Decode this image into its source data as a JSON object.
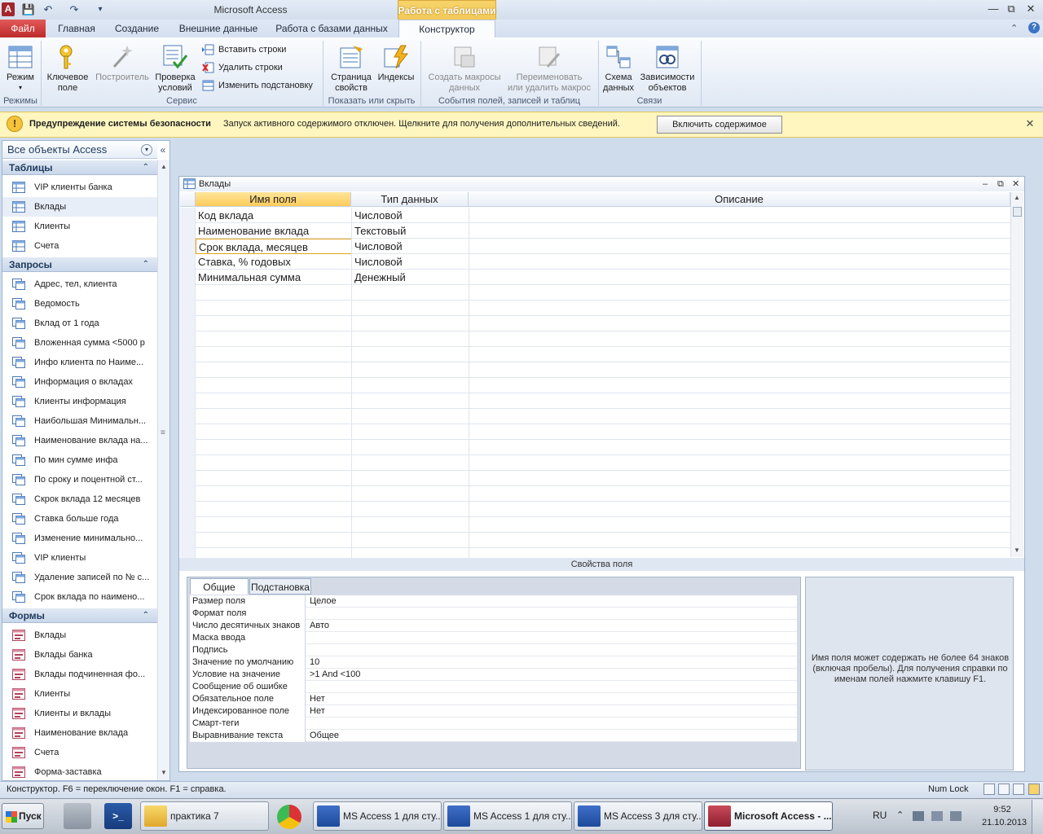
{
  "window": {
    "title": "Microsoft Access",
    "context_tab_group": "Работа с таблицами"
  },
  "tabs": {
    "file": "Файл",
    "home": "Главная",
    "create": "Создание",
    "external": "Внешние данные",
    "database_tools": "Работа с базами данных",
    "design": "Конструктор"
  },
  "ribbon": {
    "view": "Режим",
    "primary_key": [
      "Ключевое",
      "поле"
    ],
    "builder": "Построитель",
    "test_rules": [
      "Проверка",
      "условий"
    ],
    "insert_rows": "Вставить строки",
    "delete_rows": "Удалить строки",
    "modify_lookups": "Изменить подстановку",
    "property_sheet": [
      "Страница",
      "свойств"
    ],
    "indexes": "Индексы",
    "create_macros": [
      "Создать макросы",
      "данных"
    ],
    "rename_macro": [
      "Переименовать",
      "или удалить макрос"
    ],
    "relationships": [
      "Схема",
      "данных"
    ],
    "dependencies": [
      "Зависимости",
      "объектов"
    ],
    "groups": {
      "views": "Режимы",
      "tools": "Сервис",
      "show_hide": "Показать или скрыть",
      "events": "События полей, записей и таблиц",
      "relationships": "Связи"
    }
  },
  "security": {
    "title": "Предупреждение системы безопасности",
    "message": "Запуск активного содержимого отключен. Щелкните для получения дополнительных сведений.",
    "button": "Включить содержимое"
  },
  "nav": {
    "header": "Все объекты Access",
    "groups": {
      "tables": "Таблицы",
      "queries": "Запросы",
      "forms": "Формы"
    },
    "tables": [
      "VIP клиенты банка",
      "Вклады",
      "Клиенты",
      "Счета"
    ],
    "queries": [
      "Адрес, тел, клиента",
      "Ведомость",
      "Вклад от 1 года",
      "Вложенная сумма <5000 р",
      "Инфо клиента по Наиме...",
      "Информация о вкладах",
      "Клиенты информация",
      "Наибольшая Минимальн...",
      "Наименование вклада на...",
      "По мин сумме инфа",
      "По сроку и поцентной ст...",
      "Скрок вклада 12 месяцев",
      "Ставка больше года",
      "Изменение минимально...",
      "VIP клиенты",
      "Удаление записей по № с...",
      "Срок вклада по наимено..."
    ],
    "forms": [
      "Вклады",
      "Вклады банка",
      "Вклады подчиненная фо...",
      "Клиенты",
      "Клиенты и вклады",
      "Наименование вклада",
      "Счета",
      "Форма-заставка"
    ]
  },
  "document": {
    "title": "Вклады",
    "columns": {
      "name": "Имя поля",
      "type": "Тип данных",
      "description": "Описание"
    },
    "rows": [
      {
        "name": "Код вклада",
        "type": "Числовой"
      },
      {
        "name": "Наименование вклада",
        "type": "Текстовый"
      },
      {
        "name": "Срок вклада, месяцев",
        "type": "Числовой"
      },
      {
        "name": "Ставка, % годовых",
        "type": "Числовой"
      },
      {
        "name": "Минимальная сумма",
        "type": "Денежный"
      }
    ]
  },
  "properties": {
    "title": "Свойства поля",
    "tab_general": "Общие",
    "tab_lookup": "Подстановка",
    "rows": [
      {
        "label": "Размер поля",
        "value": "Целое"
      },
      {
        "label": "Формат поля",
        "value": ""
      },
      {
        "label": "Число десятичных знаков",
        "value": "Авто"
      },
      {
        "label": "Маска ввода",
        "value": ""
      },
      {
        "label": "Подпись",
        "value": ""
      },
      {
        "label": "Значение по умолчанию",
        "value": "10"
      },
      {
        "label": "Условие на значение",
        "value": ">1 And <100"
      },
      {
        "label": "Сообщение об ошибке",
        "value": ""
      },
      {
        "label": "Обязательное поле",
        "value": "Нет"
      },
      {
        "label": "Индексированное поле",
        "value": "Нет"
      },
      {
        "label": "Смарт-теги",
        "value": ""
      },
      {
        "label": "Выравнивание текста",
        "value": "Общее"
      }
    ],
    "help": "Имя поля может содержать не более 64 знаков (включая пробелы). Для получения справки по именам полей нажмите клавишу F1."
  },
  "status": {
    "text": "Конструктор.  F6 = переключение окон.  F1 = справка.",
    "numlock": "Num Lock"
  },
  "taskbar": {
    "start": "Пуск",
    "items": [
      "практика 7",
      "MS Access 1 для сту...",
      "MS Access 1 для сту...",
      "MS Access 3 для сту...",
      "Microsoft Access - ..."
    ],
    "lang": "RU",
    "time": "9:52",
    "date": "21.10.2013"
  }
}
